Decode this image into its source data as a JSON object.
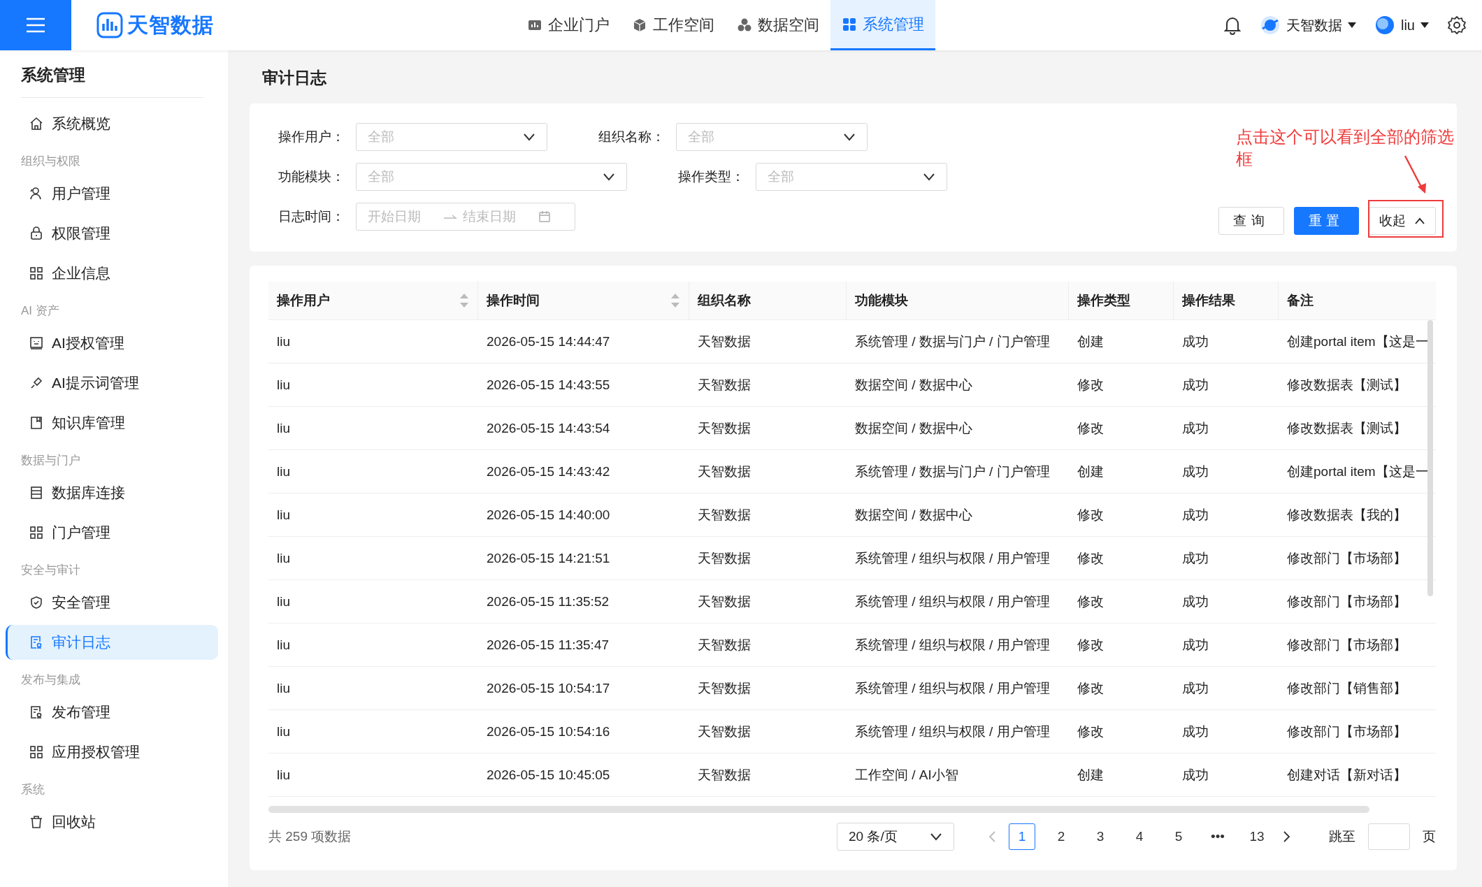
{
  "header": {
    "logo": "天智数据",
    "nav": [
      {
        "label": "企业门户",
        "selected": false
      },
      {
        "label": "工作空间",
        "selected": false
      },
      {
        "label": "数据空间",
        "selected": false
      },
      {
        "label": "系统管理",
        "selected": true
      }
    ],
    "org": "天智数据",
    "user": "liu"
  },
  "sidebar": {
    "title": "系统管理",
    "sections": [
      {
        "items": [
          {
            "label": "系统概览",
            "selected": false
          }
        ]
      },
      {
        "heading": "组织与权限",
        "items": [
          {
            "label": "用户管理",
            "selected": false
          },
          {
            "label": "权限管理",
            "selected": false
          },
          {
            "label": "企业信息",
            "selected": false
          }
        ]
      },
      {
        "heading": "AI 资产",
        "items": [
          {
            "label": "AI授权管理",
            "selected": false
          },
          {
            "label": "AI提示词管理",
            "selected": false
          },
          {
            "label": "知识库管理",
            "selected": false
          }
        ]
      },
      {
        "heading": "数据与门户",
        "items": [
          {
            "label": "数据库连接",
            "selected": false
          },
          {
            "label": "门户管理",
            "selected": false
          }
        ]
      },
      {
        "heading": "安全与审计",
        "items": [
          {
            "label": "安全管理",
            "selected": false
          },
          {
            "label": "审计日志",
            "selected": true
          }
        ]
      },
      {
        "heading": "发布与集成",
        "items": [
          {
            "label": "发布管理",
            "selected": false
          },
          {
            "label": "应用授权管理",
            "selected": false
          }
        ]
      },
      {
        "heading": "系统",
        "items": [
          {
            "label": "回收站",
            "selected": false
          }
        ]
      }
    ]
  },
  "page_title": "审计日志",
  "filters": [
    [
      {
        "kind": "select",
        "label": "操作用户：",
        "placeholder": "全部"
      },
      {
        "kind": "select",
        "label": "组织名称：",
        "placeholder": "全部"
      }
    ],
    [
      {
        "kind": "select",
        "label": "功能模块：",
        "placeholder": "全部"
      },
      {
        "kind": "select",
        "label": "操作类型：",
        "placeholder": "全部"
      }
    ],
    [
      {
        "kind": "daterange",
        "label": "日志时间：",
        "placeholder": "开始日期",
        "placeholder_end": "结束日期"
      }
    ]
  ],
  "buttons": [
    {
      "label": "查询",
      "kind": "default"
    },
    {
      "label": "重置",
      "kind": "primary"
    },
    {
      "label": "收起",
      "kind": "collapse"
    }
  ],
  "annotation": "点击这个可以看到全部的筛选框",
  "table": {
    "columns": [
      "操作用户",
      "操作时间",
      "组织名称",
      "功能模块",
      "操作类型",
      "操作结果",
      "备注"
    ],
    "rows": [
      [
        "liu",
        "2026-05-15 14:44:47",
        "天智数据",
        "系统管理 / 数据与门户 / 门户管理",
        "创建",
        "成功",
        "创建portal item【这是一"
      ],
      [
        "liu",
        "2026-05-15 14:43:55",
        "天智数据",
        "数据空间 / 数据中心",
        "修改",
        "成功",
        "修改数据表【测试】"
      ],
      [
        "liu",
        "2026-05-15 14:43:54",
        "天智数据",
        "数据空间 / 数据中心",
        "修改",
        "成功",
        "修改数据表【测试】"
      ],
      [
        "liu",
        "2026-05-15 14:43:42",
        "天智数据",
        "系统管理 / 数据与门户 / 门户管理",
        "创建",
        "成功",
        "创建portal item【这是一"
      ],
      [
        "liu",
        "2026-05-15 14:40:00",
        "天智数据",
        "数据空间 / 数据中心",
        "修改",
        "成功",
        "修改数据表【我的】"
      ],
      [
        "liu",
        "2026-05-15 14:21:51",
        "天智数据",
        "系统管理 / 组织与权限 / 用户管理",
        "修改",
        "成功",
        "修改部门【市场部】"
      ],
      [
        "liu",
        "2026-05-15 11:35:52",
        "天智数据",
        "系统管理 / 组织与权限 / 用户管理",
        "修改",
        "成功",
        "修改部门【市场部】"
      ],
      [
        "liu",
        "2026-05-15 11:35:47",
        "天智数据",
        "系统管理 / 组织与权限 / 用户管理",
        "修改",
        "成功",
        "修改部门【市场部】"
      ],
      [
        "liu",
        "2026-05-15 10:54:17",
        "天智数据",
        "系统管理 / 组织与权限 / 用户管理",
        "修改",
        "成功",
        "修改部门【销售部】"
      ],
      [
        "liu",
        "2026-05-15 10:54:16",
        "天智数据",
        "系统管理 / 组织与权限 / 用户管理",
        "修改",
        "成功",
        "修改部门【市场部】"
      ],
      [
        "liu",
        "2026-05-15 10:45:05",
        "天智数据",
        "工作空间 / AI小智",
        "创建",
        "成功",
        "创建对话【新对话】"
      ]
    ]
  },
  "pagination": {
    "total": "共 259 项数据",
    "page_size": "20 条/页",
    "pages": [
      {
        "label": "1",
        "selected": true
      },
      {
        "label": "2",
        "selected": false
      },
      {
        "label": "3",
        "selected": false
      },
      {
        "label": "4",
        "selected": false
      },
      {
        "label": "5",
        "selected": false
      },
      {
        "label": "•••",
        "selected": false
      },
      {
        "label": "13",
        "selected": false
      }
    ],
    "jump_label": "跳至",
    "jump_unit": "页"
  }
}
